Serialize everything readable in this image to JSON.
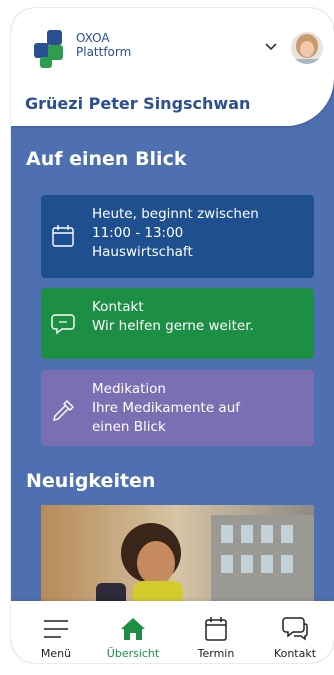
{
  "header": {
    "brand_line1": "OXOA",
    "brand_line2": "Plattform",
    "greeting": "Grüezi Peter Singschwan"
  },
  "overview": {
    "title": "Auf einen Blick",
    "cards": [
      {
        "lines": [
          "Heute, beginnt zwischen",
          "11:00 - 13:00",
          "Hauswirtschaft"
        ],
        "icon": "calendar-icon"
      },
      {
        "lines": [
          "Kontakt",
          "Wir helfen gerne weiter."
        ],
        "icon": "chat-icon"
      },
      {
        "lines": [
          "Medikation",
          "Ihre Medikamente auf",
          "einen Blick"
        ],
        "icon": "pipette-icon"
      }
    ]
  },
  "news": {
    "title": "Neuigkeiten"
  },
  "tabbar": {
    "items": [
      {
        "label": "Menü",
        "icon": "menu-icon"
      },
      {
        "label": "Übersicht",
        "icon": "home-icon",
        "active": true
      },
      {
        "label": "Termin",
        "icon": "calendar-icon"
      },
      {
        "label": "Kontakt",
        "icon": "chat-icon"
      }
    ]
  },
  "colors": {
    "background": "#4e6fb0",
    "brand_blue": "#2b4f93",
    "card_blue": "#1e4f8e",
    "card_green": "#1d8f44",
    "card_purple": "#7b6eb3",
    "active_tab": "#1d8f44"
  }
}
